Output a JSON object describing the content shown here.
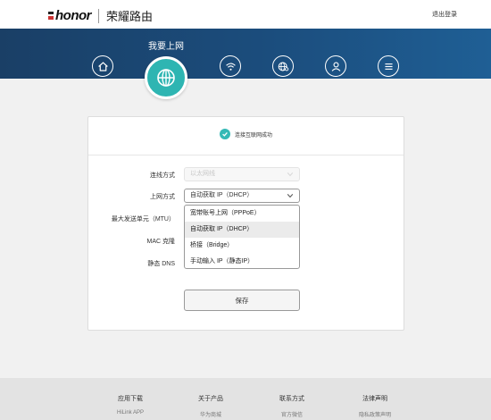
{
  "header": {
    "logo_text": "honor",
    "brand_name": "荣耀路由",
    "logout_label": "退出登录"
  },
  "nav": {
    "active_caption": "我要上网",
    "items": [
      {
        "icon": "home-icon"
      },
      {
        "icon": "globe-icon",
        "active": true
      },
      {
        "icon": "wifi-icon"
      },
      {
        "icon": "globe-settings-icon"
      },
      {
        "icon": "user-icon"
      },
      {
        "icon": "menu-icon"
      }
    ]
  },
  "status": {
    "text": "连接互联网成功"
  },
  "form": {
    "connection_mode": {
      "label": "连线方式",
      "value": "以太网线"
    },
    "internet_mode": {
      "label": "上网方式",
      "value": "自动获取 IP（DHCP）",
      "options": [
        "宽带账号上网（PPPoE）",
        "自动获取 IP（DHCP）",
        "桥接（Bridge）",
        "手动输入 IP（静态IP）"
      ],
      "selected_index": 1
    },
    "mtu_label": "最大发送单元（MTU）",
    "mac_clone_label": "MAC 克隆",
    "static_dns_label": "静态 DNS",
    "save_label": "保存"
  },
  "footer": {
    "columns": [
      {
        "heading": "应用下载",
        "link": "HiLink APP"
      },
      {
        "heading": "关于产品",
        "link": "华为商城"
      },
      {
        "heading": "联系方式",
        "link": "官方微信"
      },
      {
        "heading": "法律声明",
        "link": "隐私政策声明"
      }
    ]
  },
  "colors": {
    "banner_dark": "#1a3f66",
    "accent_teal": "#2eb5b2",
    "footer_bg": "#e3e3e3"
  }
}
